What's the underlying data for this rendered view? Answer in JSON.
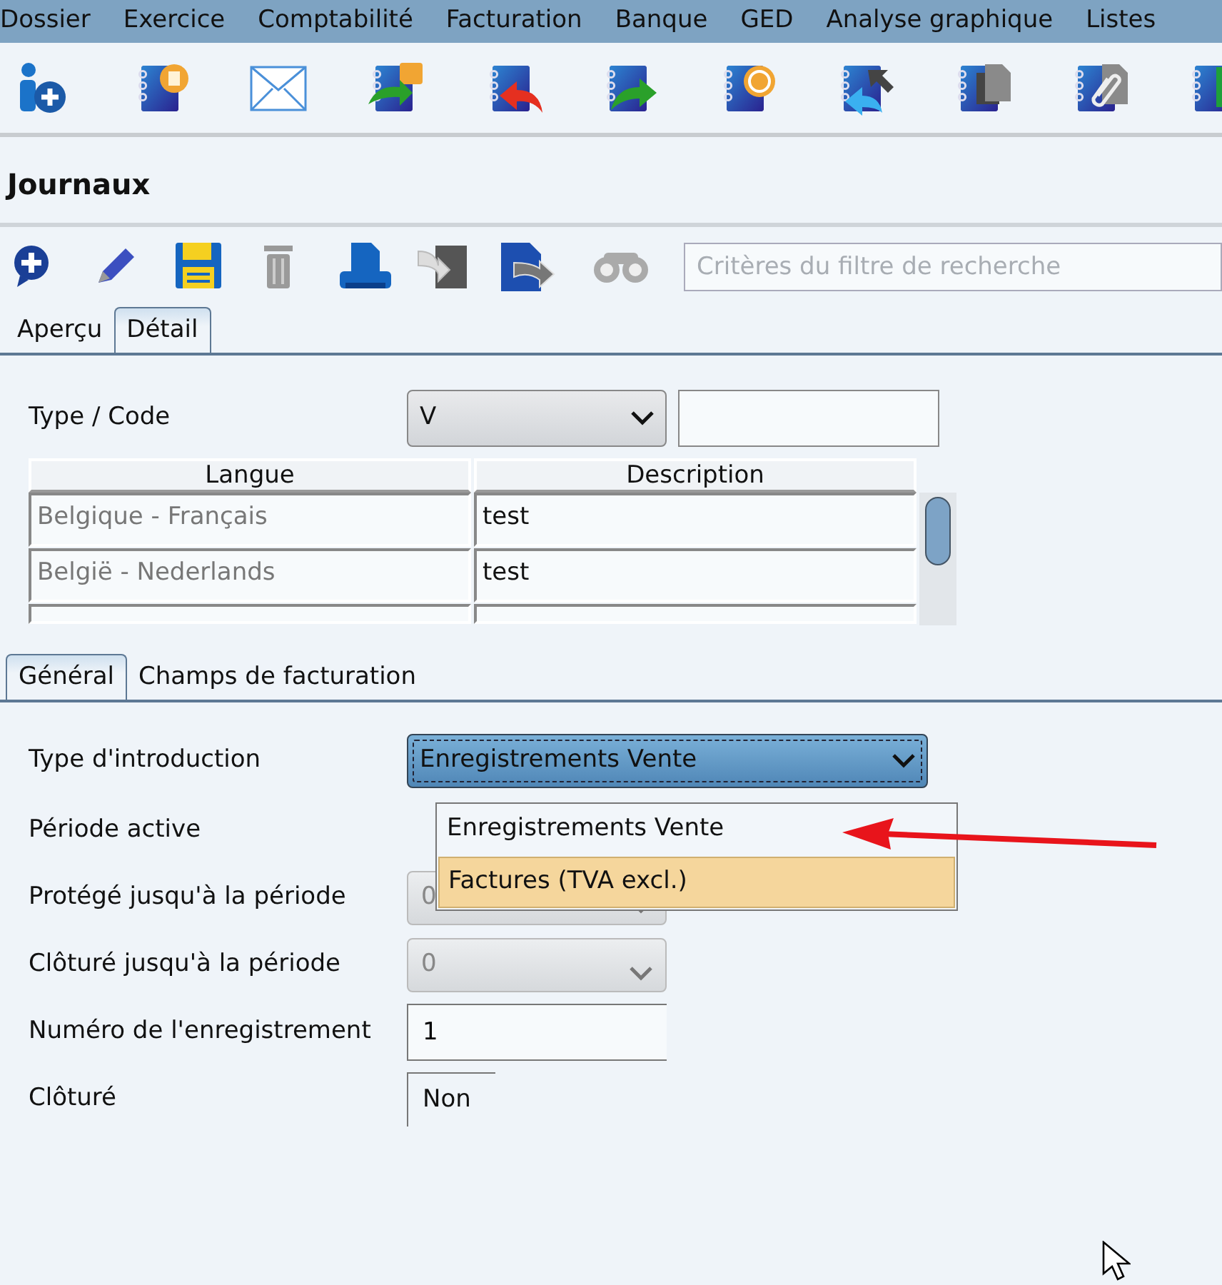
{
  "menu_bar": [
    {
      "label": "Dossier"
    },
    {
      "label": "Exercice"
    },
    {
      "label": "Comptabilité"
    },
    {
      "label": "Facturation"
    },
    {
      "label": "Banque"
    },
    {
      "label": "GED"
    },
    {
      "label": "Analyse graphique"
    },
    {
      "label": "Listes"
    }
  ],
  "page_title": "Journaux",
  "search": {
    "placeholder": "Critères du filtre de recherche"
  },
  "tabs": [
    {
      "label": "Aperçu",
      "selected": false
    },
    {
      "label": "Détail",
      "selected": true
    }
  ],
  "type_code": {
    "label": "Type / Code",
    "type_value": "V"
  },
  "languages_table": {
    "columns": [
      "Langue",
      "Description"
    ],
    "rows": [
      {
        "langue": "Belgique - Français",
        "description": "test"
      },
      {
        "langue": "België - Nederlands",
        "description": "test"
      },
      {}
    ]
  },
  "sub_tabs": [
    {
      "label": "Général",
      "selected": true
    },
    {
      "label": "Champs de facturation",
      "selected": false
    }
  ],
  "form": [
    {
      "kind": "dropdown",
      "label": "Type d'introduction",
      "value": "Enregistrements Vente",
      "expanded": true,
      "options": [
        {
          "label": "Enregistrements Vente",
          "highlighted": false
        },
        {
          "label": "Factures (TVA excl.)",
          "highlighted": true
        }
      ]
    },
    {
      "kind": "hidden",
      "label": "Période active"
    },
    {
      "kind": "select",
      "label": "Protégé jusqu'à la période",
      "value": "0",
      "disabled": true
    },
    {
      "kind": "select",
      "label": "Clôturé jusqu'à la période",
      "value": "0",
      "disabled": true
    },
    {
      "kind": "input",
      "label": "Numéro de l'enregistrement",
      "value": "1"
    },
    {
      "kind": "readonly",
      "label": "Clôturé",
      "value": "Non"
    }
  ]
}
